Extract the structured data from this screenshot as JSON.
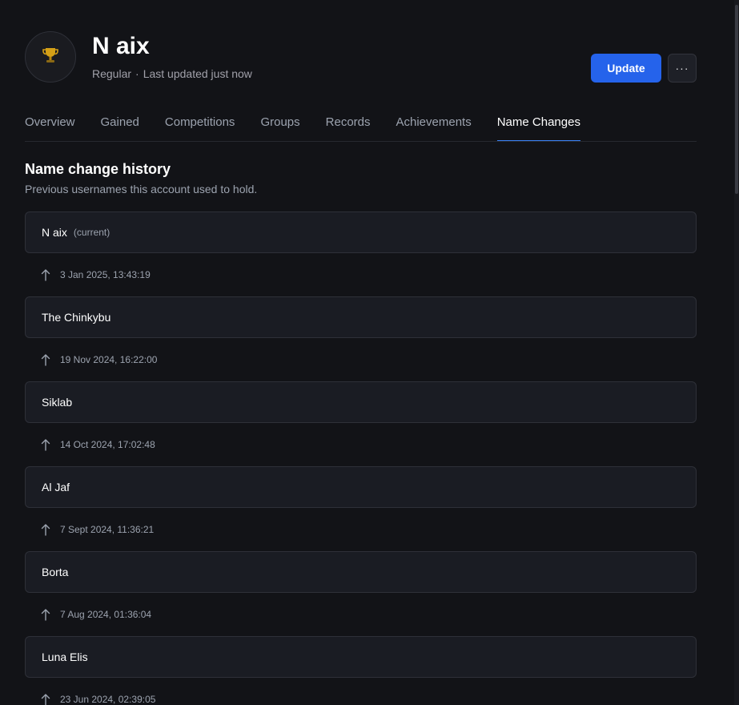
{
  "player": {
    "name": "N aix",
    "type": "Regular",
    "separator": "·",
    "last_updated": "Last updated just now",
    "avatar_icon": "trophy-icon"
  },
  "actions": {
    "update_label": "Update",
    "more_label": "···"
  },
  "tabs": [
    {
      "label": "Overview",
      "active": false
    },
    {
      "label": "Gained",
      "active": false
    },
    {
      "label": "Competitions",
      "active": false
    },
    {
      "label": "Groups",
      "active": false
    },
    {
      "label": "Records",
      "active": false
    },
    {
      "label": "Achievements",
      "active": false
    },
    {
      "label": "Name Changes",
      "active": true
    }
  ],
  "section": {
    "title": "Name change history",
    "subtitle": "Previous usernames this account used to hold."
  },
  "history": {
    "current_tag": "(current)",
    "names": [
      "N aix",
      "The Chinkybu",
      "Siklab",
      "Al Jaf",
      "Borta",
      "Luna Elis"
    ],
    "dates": [
      "3 Jan 2025, 13:43:19",
      "19 Nov 2024, 16:22:00",
      "14 Oct 2024, 17:02:48",
      "7 Sept 2024, 11:36:21",
      "7 Aug 2024, 01:36:04",
      "23 Jun 2024, 02:39:05"
    ]
  },
  "colors": {
    "background": "#121317",
    "card": "#1a1c23",
    "accent": "#2563eb",
    "muted_text": "#9ca3af"
  }
}
